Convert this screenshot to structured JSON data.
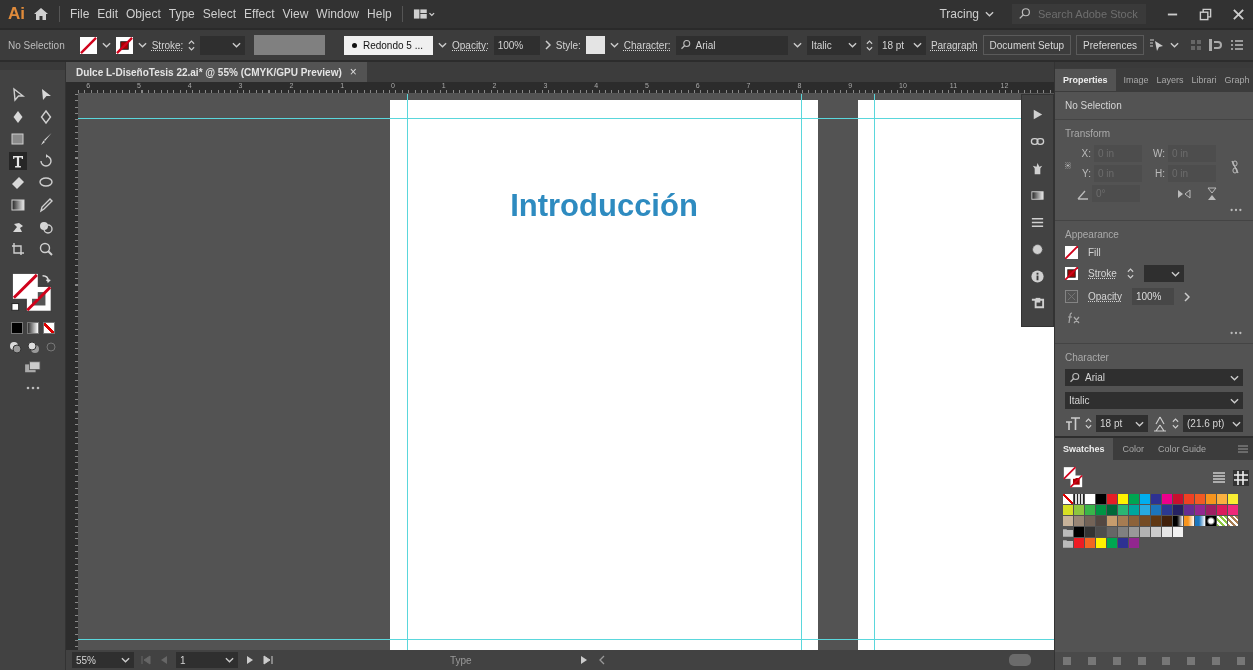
{
  "menu_bar": {
    "logo": "Ai",
    "menus": [
      "File",
      "Edit",
      "Object",
      "Type",
      "Select",
      "Effect",
      "View",
      "Window",
      "Help"
    ],
    "workspace": "Tracing",
    "search": {
      "placeholder": "Search Adobe Stock"
    }
  },
  "control_bar": {
    "selection": "No Selection",
    "stroke_label": "Stroke:",
    "brush": "Redondo 5 ...",
    "opacity_label": "Opacity:",
    "opacity": "100%",
    "style_label": "Style:",
    "character_label": "Character:",
    "font": "Arial",
    "font_style": "Italic",
    "font_size": "18 pt",
    "paragraph": "Paragraph",
    "buttons": [
      "Document Setup",
      "Preferences"
    ]
  },
  "toolbar": {
    "tools": [
      {
        "selected": false
      },
      {
        "selected": false
      },
      {
        "selected": false
      },
      {
        "selected": false
      },
      {
        "selected": false
      },
      {
        "selected": false
      },
      {
        "selected": true
      },
      {
        "selected": false
      },
      {
        "selected": false
      },
      {
        "selected": false
      },
      {
        "selected": false
      },
      {
        "selected": false
      },
      {
        "selected": false
      },
      {
        "selected": false
      },
      {
        "selected": false
      },
      {
        "selected": false
      }
    ]
  },
  "document_tab": {
    "title": "Dulce L-DiseñoTesis 22.ai* @ 55% (CMYK/GPU Preview)",
    "close": "×"
  },
  "ruler": {
    "labels": [
      "6",
      "5",
      "4",
      "3",
      "2",
      "1",
      "0",
      "1",
      "2",
      "3",
      "4",
      "5",
      "6",
      "7",
      "8",
      "9",
      "10",
      "11",
      "12"
    ]
  },
  "artboard": {
    "heading": "Introducción"
  },
  "status_bar": {
    "zoom": "55%",
    "page": "1",
    "tool": "Type"
  },
  "properties_panel": {
    "tabs": [
      {
        "label": "Properties",
        "selected": true
      },
      {
        "label": "Image",
        "selected": false
      },
      {
        "label": "Layers",
        "selected": false
      },
      {
        "label": "Librari",
        "selected": false
      },
      {
        "label": "Graph",
        "selected": false
      }
    ],
    "selection": "No Selection",
    "transform": {
      "title": "Transform",
      "fields": [
        {
          "label": "X:",
          "value": "0 in"
        },
        {
          "label": "W:",
          "value": "0 in"
        },
        {
          "label": "Y:",
          "value": "0 in"
        },
        {
          "label": "H:",
          "value": "0 in"
        }
      ],
      "angle": "0°"
    },
    "appearance": {
      "title": "Appearance",
      "fill": "Fill",
      "stroke": "Stroke",
      "opacity_label": "Opacity",
      "opacity": "100%"
    },
    "character": {
      "title": "Character",
      "font": "Arial",
      "style": "Italic",
      "size": "18 pt",
      "leading": "(21.6 pt)"
    }
  },
  "swatches_panel": {
    "tabs": [
      {
        "label": "Swatches",
        "selected": true
      },
      {
        "label": "Color",
        "selected": false
      },
      {
        "label": "Color Guide",
        "selected": false
      }
    ],
    "rows": [
      {
        "group": false,
        "swatches": [
          {
            "kind": "none"
          },
          {
            "kind": "registration"
          },
          {
            "kind": "color",
            "color": "#ffffff"
          },
          {
            "kind": "color",
            "color": "#000000"
          },
          {
            "kind": "color",
            "color": "#e41e26"
          },
          {
            "kind": "color",
            "color": "#fff200"
          },
          {
            "kind": "color",
            "color": "#00a651"
          },
          {
            "kind": "color",
            "color": "#00aeef"
          },
          {
            "kind": "color",
            "color": "#2e3192"
          },
          {
            "kind": "color",
            "color": "#ec008c"
          },
          {
            "kind": "color",
            "color": "#c8102e"
          },
          {
            "kind": "color",
            "color": "#ef4123"
          },
          {
            "kind": "color",
            "color": "#f15a24"
          },
          {
            "kind": "color",
            "color": "#f7941d"
          },
          {
            "kind": "color",
            "color": "#fbb040"
          },
          {
            "kind": "color",
            "color": "#f9ed32"
          }
        ]
      },
      {
        "group": false,
        "swatches": [
          {
            "kind": "color",
            "color": "#d7df23"
          },
          {
            "kind": "color",
            "color": "#8dc63f"
          },
          {
            "kind": "color",
            "color": "#39b54a"
          },
          {
            "kind": "color",
            "color": "#009444"
          },
          {
            "kind": "color",
            "color": "#006838"
          },
          {
            "kind": "color",
            "color": "#2bb673"
          },
          {
            "kind": "color",
            "color": "#00a79d"
          },
          {
            "kind": "color",
            "color": "#27aae1"
          },
          {
            "kind": "color",
            "color": "#1c75bc"
          },
          {
            "kind": "color",
            "color": "#2b3990"
          },
          {
            "kind": "color",
            "color": "#262262"
          },
          {
            "kind": "color",
            "color": "#662d91"
          },
          {
            "kind": "color",
            "color": "#92278f"
          },
          {
            "kind": "color",
            "color": "#9e1f63"
          },
          {
            "kind": "color",
            "color": "#da1c5c"
          },
          {
            "kind": "color",
            "color": "#ee2a7b"
          }
        ]
      },
      {
        "group": false,
        "swatches": [
          {
            "kind": "color",
            "color": "#c7b299"
          },
          {
            "kind": "color",
            "color": "#998675"
          },
          {
            "kind": "color",
            "color": "#736357"
          },
          {
            "kind": "color",
            "color": "#534741"
          },
          {
            "kind": "color",
            "color": "#c69c6d"
          },
          {
            "kind": "color",
            "color": "#a67c52"
          },
          {
            "kind": "color",
            "color": "#8c6239"
          },
          {
            "kind": "color",
            "color": "#754c24"
          },
          {
            "kind": "color",
            "color": "#603813"
          },
          {
            "kind": "color",
            "color": "#42210b"
          },
          {
            "kind": "gradient",
            "color": "#000000"
          },
          {
            "kind": "gradient",
            "color": "#f7941d"
          },
          {
            "kind": "gradient",
            "color": "#1c75bc"
          },
          {
            "kind": "radial",
            "color": "#000000"
          },
          {
            "kind": "pattern",
            "color": "#8dc63f"
          },
          {
            "kind": "pattern",
            "color": "#a67c52"
          }
        ]
      },
      {
        "group": true,
        "swatches": [
          {
            "kind": "color",
            "color": "#000000"
          },
          {
            "kind": "color",
            "color": "#333333"
          },
          {
            "kind": "color",
            "color": "#4d4d4d"
          },
          {
            "kind": "color",
            "color": "#666666"
          },
          {
            "kind": "color",
            "color": "#808080"
          },
          {
            "kind": "color",
            "color": "#999999"
          },
          {
            "kind": "color",
            "color": "#b3b3b3"
          },
          {
            "kind": "color",
            "color": "#cccccc"
          },
          {
            "kind": "color",
            "color": "#e6e6e6"
          },
          {
            "kind": "color",
            "color": "#f2f2f2"
          }
        ]
      },
      {
        "group": true,
        "swatches": [
          {
            "kind": "color",
            "color": "#ed1c24"
          },
          {
            "kind": "color",
            "color": "#f26522"
          },
          {
            "kind": "color",
            "color": "#fff200"
          },
          {
            "kind": "color",
            "color": "#00a651"
          },
          {
            "kind": "color",
            "color": "#2e3192"
          },
          {
            "kind": "color",
            "color": "#92278f"
          }
        ]
      }
    ]
  }
}
